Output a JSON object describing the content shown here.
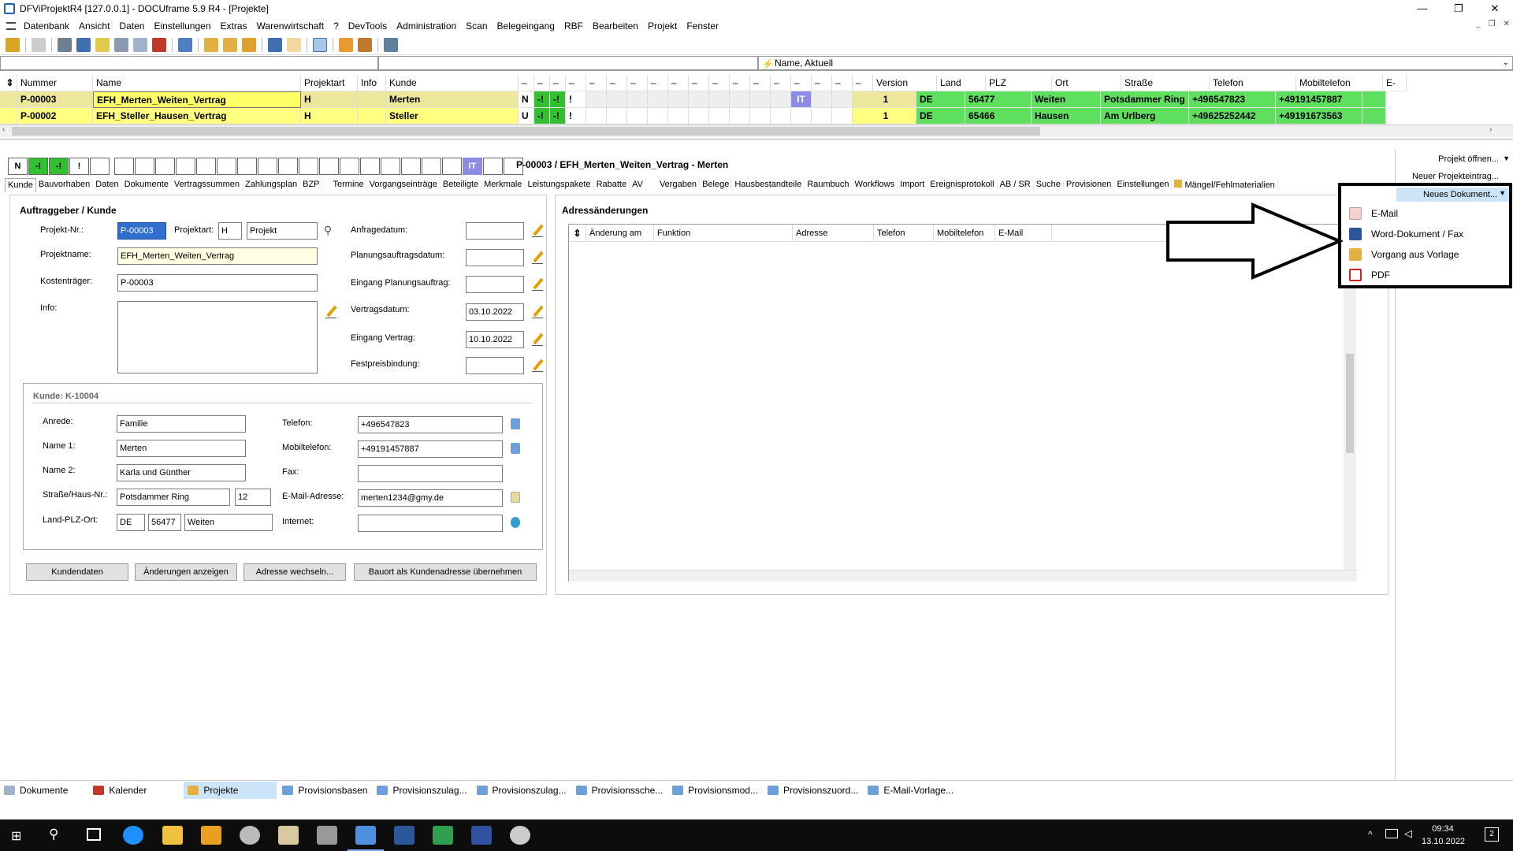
{
  "window": {
    "title": "DFViProjektR4 [127.0.0.1] - DOCUframe 5.9 R4 - [Projekte]"
  },
  "menu": [
    "Datenbank",
    "Ansicht",
    "Daten",
    "Einstellungen",
    "Extras",
    "Warenwirtschaft",
    "?",
    "DevTools",
    "Administration",
    "Scan",
    "Belegeingang",
    "RBF",
    "Bearbeiten",
    "Projekt",
    "Fenster"
  ],
  "filter": {
    "label": "Name, Aktuell"
  },
  "grid": {
    "headers": {
      "nummer": "Nummer",
      "name": "Name",
      "projektart": "Projektart",
      "info": "Info",
      "kunde": "Kunde",
      "flag": "–",
      "version": "Version",
      "land": "Land",
      "plz": "PLZ",
      "ort": "Ort",
      "strasse": "Straße",
      "telefon": "Telefon",
      "mobil": "Mobiltelefon",
      "email": "E-"
    },
    "rows": [
      {
        "nummer": "P-00003",
        "name": "EFH_Merten_Weiten_Vertrag",
        "projektart": "H",
        "info": "",
        "kunde": "Merten",
        "f1": "N",
        "f2": "-!",
        "f3": "-!",
        "f4": "!",
        "it": "IT",
        "version": "1",
        "land": "DE",
        "plz": "56477",
        "ort": "Weiten",
        "strasse": "Potsdammer Ring",
        "telefon": "+496547823",
        "mobil": "+49191457887"
      },
      {
        "nummer": "P-00002",
        "name": "EFH_Steller_Hausen_Vertrag",
        "projektart": "H",
        "info": "",
        "kunde": "Steller",
        "f1": "U",
        "f2": "-!",
        "f3": "-!",
        "f4": "!",
        "it": "",
        "version": "1",
        "land": "DE",
        "plz": "65466",
        "ort": "Hausen",
        "strasse": "Am Urlberg",
        "telefon": "+49625252442",
        "mobil": "+49191673563"
      }
    ]
  },
  "rowbar": {
    "b1": "N",
    "b2": "-!",
    "b3": "-!",
    "b4": "!",
    "it": "IT",
    "caption": "P-00003 / EFH_Merten_Weiten_Vertrag - Merten"
  },
  "tabs": [
    "Kunde",
    "Bauvorhaben",
    "Daten",
    "Dokumente",
    "Vertragssummen",
    "Zahlungsplan",
    "BZP",
    "Termine",
    "Vorgangseinträge",
    "Beteiligte",
    "Merkmale",
    "Leistungspakete",
    "Rabatte",
    "AV",
    "Vergaben",
    "Belege",
    "Hausbestandteile",
    "Raumbuch",
    "Workflows",
    "Import",
    "Ereignisprotokoll",
    "AB / SR",
    "Suche",
    "Provisionen",
    "Einstellungen",
    "Mängel/Fehlmaterialien"
  ],
  "form": {
    "section": "Auftraggeber / Kunde",
    "projekt_nr_label": "Projekt-Nr.:",
    "projekt_nr": "P-00003",
    "projektart_label": "Projektart:",
    "projektart": "H",
    "projektart_text": "Projekt",
    "projektname_label": "Projektname:",
    "projektname": "EFH_Merten_Weiten_Vertrag",
    "kostentraeger_label": "Kostenträger:",
    "kostentraeger": "P-00003",
    "info_label": "Info:",
    "anfragedatum_label": "Anfragedatum:",
    "anfragedatum": "",
    "planung_label": "Planungsauftragsdatum:",
    "planung": "",
    "eingang_planung_label": "Eingang Planungsauftrag:",
    "eingang_planung": "",
    "vertragsdatum_label": "Vertragsdatum:",
    "vertragsdatum": "03.10.2022",
    "eingang_vertrag_label": "Eingang Vertrag:",
    "eingang_vertrag": "10.10.2022",
    "festpreis_label": "Festpreisbindung:",
    "festpreis": ""
  },
  "kunde": {
    "title": "Kunde: K-10004",
    "anrede_label": "Anrede:",
    "anrede": "Familie",
    "name1_label": "Name 1:",
    "name1": "Merten",
    "name2_label": "Name 2:",
    "name2": "Karla und Günther",
    "strasse_label": "Straße/Haus-Nr.:",
    "strasse": "Potsdammer Ring",
    "hausnr": "12",
    "lpo_label": "Land-PLZ-Ort:",
    "land": "DE",
    "plz": "56477",
    "ort": "Weiten",
    "telefon_label": "Telefon:",
    "telefon": "+496547823",
    "mobil_label": "Mobiltelefon:",
    "mobil": "+49191457887",
    "fax_label": "Fax:",
    "fax": "",
    "email_label": "E-Mail-Adresse:",
    "email": "merten1234@gmy.de",
    "internet_label": "Internet:",
    "internet": ""
  },
  "buttons": {
    "kundendaten": "Kundendaten",
    "aenderungen": "Änderungen anzeigen",
    "adresse": "Adresse wechseln...",
    "bauort": "Bauort als Kundenadresse übernehmen"
  },
  "adress": {
    "title": "Adressänderungen",
    "columns": [
      "Änderung am",
      "Funktion",
      "Adresse",
      "Telefon",
      "Mobiltelefon",
      "E-Mail"
    ]
  },
  "rightpanel": {
    "projekt_oeffnen": "Projekt öffnen...",
    "neuer_eintrag": "Neuer Projekteintrag...",
    "neues_dokument": "Neues Dokument..."
  },
  "dropdown": {
    "email": "E-Mail",
    "word": "Word-Dokument / Fax",
    "vorgang": "Vorgang aus Vorlage",
    "pdf": "PDF"
  },
  "statusbar": [
    "Dokumente",
    "Kalender",
    "Projekte",
    "Provisionsbasen",
    "Provisionszulag...",
    "Provisionszulag...",
    "Provisionssche...",
    "Provisionsmod...",
    "Provisionszuord...",
    "E-Mail-Vorlage..."
  ],
  "taskbar": {
    "time": "09:34",
    "date": "13.10.2022",
    "notifications": "2"
  }
}
